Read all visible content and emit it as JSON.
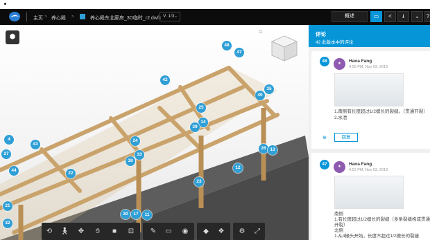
{
  "top": {
    "breadcrumb": [
      "主页",
      "养心殿",
      "养心殿东北廊房_3D临时_r2.dwfx"
    ],
    "version_label": "V. 1/3",
    "overview_label": "概述",
    "icons": [
      "comment-icon",
      "share-icon",
      "download-icon",
      "chevron-down-icon",
      "help-icon"
    ]
  },
  "viewer": {
    "pins": [
      "48",
      "47",
      "42",
      "40",
      "35",
      "25",
      "14",
      "39",
      "24",
      "38",
      "33",
      "22",
      "4",
      "43",
      "27",
      "44",
      "26",
      "13",
      "12",
      "23",
      "21",
      "30",
      "17",
      "11",
      "32"
    ]
  },
  "toolbar": {
    "icons": [
      "orbit-icon",
      "walk-icon",
      "pan-icon",
      "hand-icon",
      "camera-icon",
      "fit-icon",
      "markup-icon",
      "section-icon",
      "eye-icon",
      "explode-icon",
      "model-browser-icon",
      "settings-icon",
      "fullscreen-icon"
    ]
  },
  "panel": {
    "title": "评论",
    "subtitle": "42 此版本中的评论",
    "comments": [
      {
        "badge": "48",
        "author": "Hana Fang",
        "date": "4:56 PM, Nov 03, 2016",
        "lines": [
          "1.南侧有长度超过1/2檩长的裂缝。（贯通开裂）",
          "2.水渍"
        ],
        "reply": "回复"
      },
      {
        "badge": "47",
        "author": "Hana Fang",
        "date": "4:53 PM, Nov 03, 2016",
        "lines": [
          "南侧",
          "1.有长度超过1/2檩长的裂缝（多条裂缝构成贯通",
          "开裂）",
          "北侧",
          "1.从4椽头开始，长度不超过1/2檩长的裂缝"
        ]
      }
    ]
  },
  "colors": {
    "accent": "#0696d7",
    "topbar": "#0c0c0c",
    "pin": "#2f9fd6",
    "wood": "#c9a36b"
  }
}
